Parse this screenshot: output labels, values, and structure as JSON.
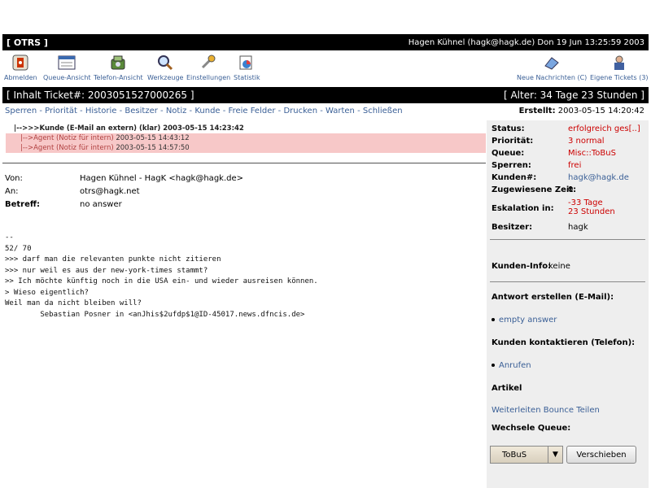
{
  "titlebar": {
    "app": "[ OTRS ]",
    "user_info": "Hagen Kühnel (hagk@hagk.de) Don 19 Jun 13:25:59 2003"
  },
  "toolbar": {
    "left": [
      {
        "label": "Abmelden",
        "icon": "logout-icon"
      },
      {
        "label": "Queue-Ansicht",
        "icon": "queue-view-icon"
      },
      {
        "label": "Telefon-Ansicht",
        "icon": "phone-view-icon"
      },
      {
        "label": "Werkzeuge",
        "icon": "magnifier-icon"
      },
      {
        "label": "Einstellungen",
        "icon": "wrench-icon"
      },
      {
        "label": "Statistik",
        "icon": "stats-icon"
      }
    ],
    "right": [
      {
        "label": "Neue Nachrichten (C)",
        "icon": "new-message-icon"
      },
      {
        "label": "Eigene Tickets (3)",
        "icon": "own-tickets-icon"
      }
    ]
  },
  "ticketbar": {
    "title": "[ Inhalt Ticket#: 2003051527000265 ]",
    "age": "[ Alter: 34 Tage 23 Stunden ]"
  },
  "menu": [
    "Sperren",
    "Priorität",
    "Historie",
    "Besitzer",
    "Notiz",
    "Kunde",
    "Freie Felder",
    "Drucken",
    "Warten",
    "Schließen"
  ],
  "created": {
    "label": "Erstellt:",
    "value": "2003-05-15 14:20:42"
  },
  "thread": [
    {
      "type": "cust",
      "text": "|-->>>Kunde (E-Mail an extern) (klar) 2003-05-15 14:23:42"
    },
    {
      "type": "agent",
      "text": "|-->Agent (Notiz für intern) ",
      "ts": "2003-05-15 14:43:12"
    },
    {
      "type": "agent",
      "text": "|-->Agent (Notiz für intern) ",
      "ts": "2003-05-15 14:57:50"
    }
  ],
  "headers": {
    "from_label": "Von:",
    "from": "Hagen Kühnel - HagK <hagk@hagk.de>",
    "to_label": "An:",
    "to": "otrs@hagk.net",
    "subject_label": "Betreff:",
    "subject": "no answer"
  },
  "body": "--\n52/ 70\n>>> darf man die relevanten punkte nicht zitieren\n>>> nur weil es aus der new-york-times stammt?\n>> Ich möchte künftig noch in die USA ein- und wieder ausreisen können.\n> Wieso eigentlich?\nWeil man da nicht bleiben will?\n        Sebastian Posner in <anJhis$2ufdp$1@ID-45017.news.dfncis.de>",
  "sidebar": {
    "status_label": "Status:",
    "status": "erfolgreich ges[..]",
    "priority_label": "Priorität:",
    "priority": "3 normal",
    "queue_label": "Queue:",
    "queue": "Misc::ToBuS",
    "lock_label": "Sperren:",
    "lock": "frei",
    "customer_label": "Kunden#:",
    "customer": "hagk@hagk.de",
    "time_label": "Zugewiesene Zeit:",
    "time": "0",
    "escalation_label": "Eskalation in:",
    "escalation_1": "-33 Tage",
    "escalation_2": "23 Stunden",
    "owner_label": "Besitzer:",
    "owner": "hagk",
    "customer_info_label": "Kunden-Info:",
    "customer_info": "keine",
    "answer_heading": "Antwort erstellen (E-Mail):",
    "answer_link": "empty answer",
    "contact_heading": "Kunden kontaktieren (Telefon):",
    "contact_link": "Anrufen",
    "article_heading": "Artikel",
    "article_links": "Weiterleiten Bounce Teilen",
    "queue_heading": "Wechsele Queue:",
    "queue_select": "ToBuS",
    "move_button": "Verschieben"
  }
}
